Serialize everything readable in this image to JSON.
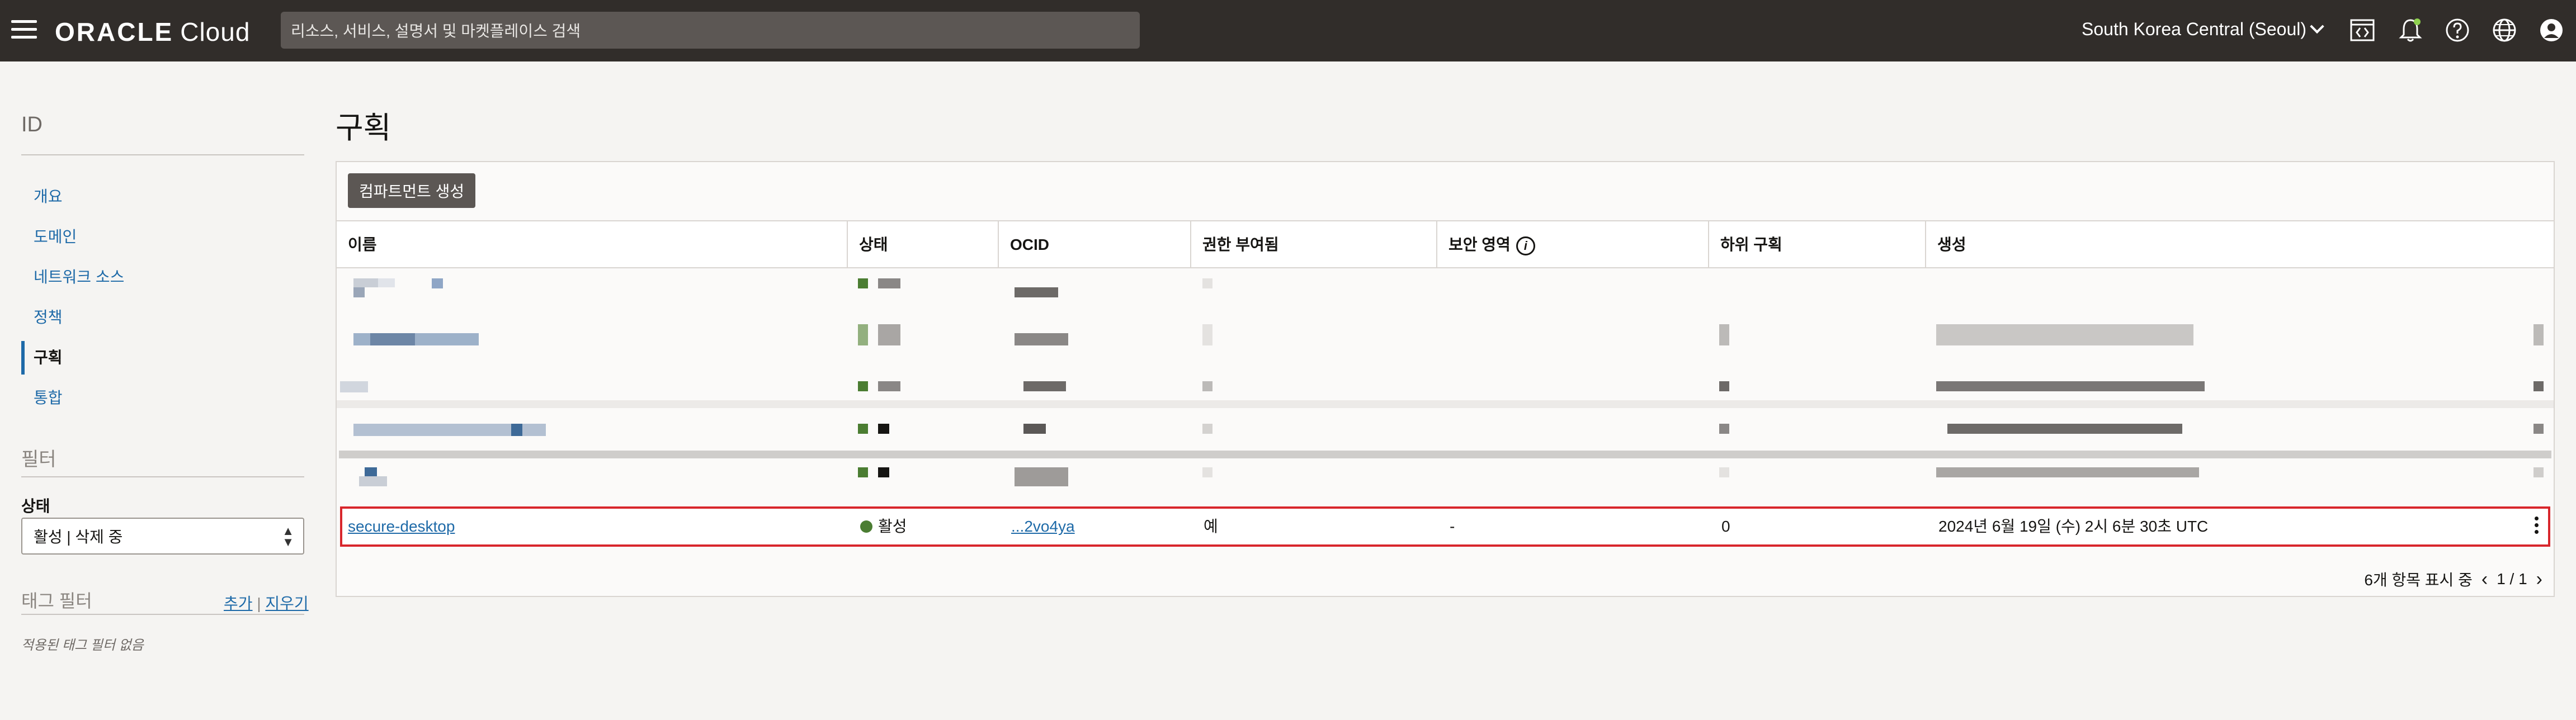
{
  "header": {
    "menu_icon": "hamburger-menu-icon",
    "logo_brand": "ORACLE",
    "logo_product": "Cloud",
    "search_placeholder": "리소스, 서비스, 설명서 및 마켓플레이스 검색",
    "region": "South Korea Central (Seoul)",
    "icons": [
      "code-editor-icon",
      "bell-icon",
      "help-icon",
      "globe-icon",
      "user-avatar-icon"
    ],
    "bell_badge_color": "#8fd14f"
  },
  "sidebar": {
    "title": "ID",
    "items": [
      {
        "label": "개요"
      },
      {
        "label": "도메인"
      },
      {
        "label": "네트워크 소스"
      },
      {
        "label": "정책"
      },
      {
        "label": "구획"
      },
      {
        "label": "통합"
      }
    ],
    "active_index": 4,
    "filter_title": "필터",
    "state_label": "상태",
    "state_value": "활성 | 삭제 중",
    "tag_filter_title": "태그 필터",
    "tag_add": "추가",
    "tag_sep": "|",
    "tag_clear": "지우기",
    "tag_empty": "적용된 태그 필터 없음"
  },
  "main": {
    "title": "구획",
    "create_button": "컴파트먼트 생성",
    "columns": [
      "이름",
      "상태",
      "OCID",
      "권한 부여됨",
      "보안 영역",
      "하위 구획",
      "생성"
    ],
    "highlighted_row": {
      "name": "secure-desktop",
      "status": "활성",
      "ocid": "...2vo4ya",
      "authorized": "예",
      "security_zone": "-",
      "subcompartments": "0",
      "created": "2024년 6월 19일 (수) 2시 6분 30초 UTC"
    },
    "footer_count": "6개 항목 표시 중",
    "footer_pages": "1 / 1"
  },
  "colors": {
    "topbar": "#312d2a",
    "link": "#1e6aa8",
    "status_green": "#4b7d32",
    "highlight_border": "#d8262c",
    "button_bg": "#5c5754"
  }
}
